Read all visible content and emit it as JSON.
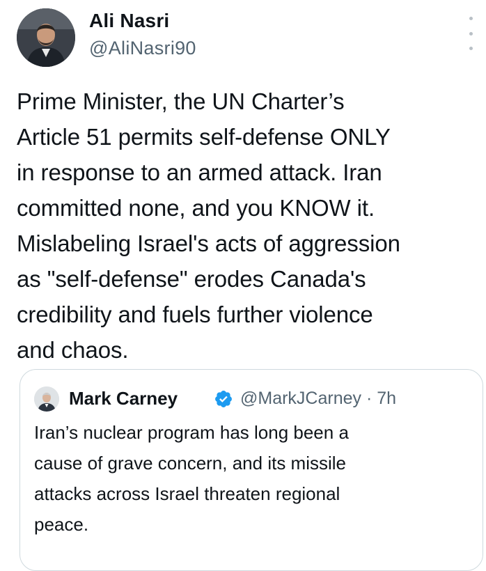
{
  "author": {
    "name": "Ali Nasri",
    "handle": "@AliNasri90"
  },
  "tweet": {
    "text": "Prime Minister, the UN Charter’s\nArticle 51 permits self-defense ONLY\nin response to an armed attack. Iran\ncommitted none,  and you KNOW it.\nMislabeling Israel's acts of aggression\nas \"self-defense\" erodes Canada's\ncredibility and fuels further violence\nand chaos."
  },
  "quoted_tweet": {
    "name": "Mark Carney",
    "verified": true,
    "handle_time": "@MarkJCarney · 7h",
    "text": "Iran’s nuclear program has long been a\ncause of grave concern, and its missile\nattacks across Israel threaten regional\npeace."
  },
  "icons": {
    "more": "more-vertical-icon",
    "verified": "verified-badge-icon"
  },
  "colors": {
    "text": "#0f1419",
    "secondary": "#536471",
    "verified": "#1d9bf0",
    "border": "#cfd9de"
  }
}
